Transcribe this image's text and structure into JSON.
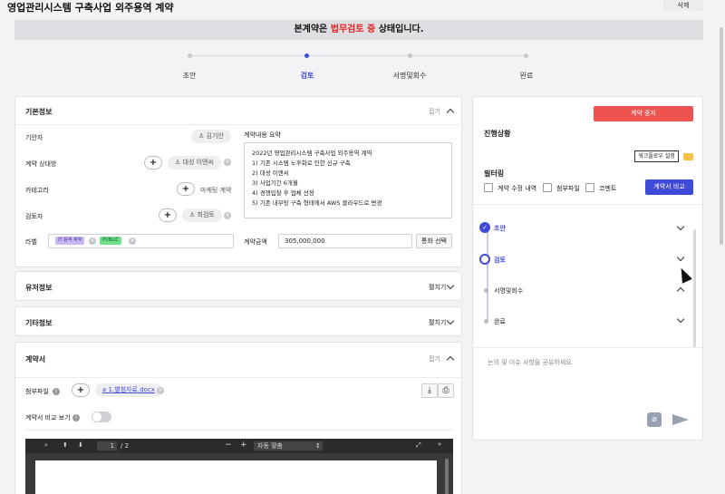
{
  "header": {
    "title": "영업관리시스템 구축사업 외주용역 계약",
    "delete_label": "삭제"
  },
  "banner": {
    "prefix": "본계약은",
    "status": "법무검토 중",
    "suffix": "상태입니다.",
    "status_color": "#e02424"
  },
  "steps": [
    {
      "label": "초안",
      "active": false
    },
    {
      "label": "검토",
      "active": true
    },
    {
      "label": "서명및회수",
      "active": false
    },
    {
      "label": "완료",
      "active": false
    }
  ],
  "basic_info": {
    "title": "기본정보",
    "fold_label": "접기",
    "drafter_label": "기안자",
    "drafter": "김기안",
    "counterparty_label": "계약 상대방",
    "counterparty": "대성 이앤씨",
    "category_label": "카테고리",
    "category": "마케팅 계약",
    "reviewer_label": "검토자",
    "reviewer": "최검토",
    "label_label": "라벨",
    "tags": [
      "IT 용역 계약",
      "PUBLIC"
    ],
    "summary_label": "계약내용 요약",
    "summary_lines": [
      "2022년 영업관리시스템 구축사업 외주용역 계약",
      "1) 기존 시스템 노후화로 인한 신규 구축",
      "2) 대성 이앤씨",
      "3) 사업기간 6개월",
      "4) 경쟁입찰 후 업체 선정",
      "5) 기존 내부망 구축 형태에서 AWS 클라우드로 변경"
    ],
    "amount_label": "계약금액",
    "amount": "305,000,000",
    "currency_btn": "통화 선택"
  },
  "maintenance": {
    "title": "유저정보",
    "expand_label": "펼치기"
  },
  "other": {
    "title": "기타정보",
    "expand_label": "펼치기"
  },
  "contract": {
    "title": "계약서",
    "fold_label": "접기",
    "attach_label": "첨부파일",
    "file_name": "1.별첨자료.docx",
    "compare_label": "계약서 비교 보기",
    "viewer": {
      "page": "1",
      "total": "/ 2",
      "zoom": "자동 맞춤"
    }
  },
  "right": {
    "stop_btn": "계약 중지",
    "stop_color": "#ef5350",
    "progress_label": "진행상황",
    "workflow_btn": "워크플로우 설정",
    "filter_label": "필터링",
    "filters": [
      "계약 수정 내역",
      "첨부파일",
      "코멘트"
    ],
    "compare_btn": "계약서 비교",
    "accent": "#3f4ad8",
    "timeline": [
      {
        "label": "초안",
        "state": "done"
      },
      {
        "label": "검토",
        "state": "current"
      },
      {
        "label": "서명및회수",
        "state": "todo"
      },
      {
        "label": "완료",
        "state": "todo"
      }
    ],
    "comment_placeholder": "논의 및 이슈 사항을 공유하세요."
  }
}
